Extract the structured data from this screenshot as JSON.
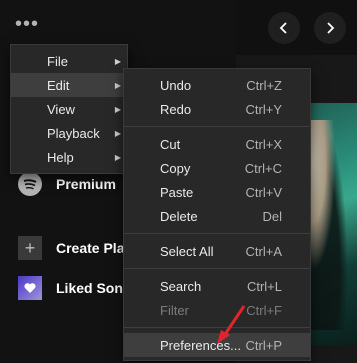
{
  "topbar": {
    "more_icon": "more-horizontal-icon",
    "back_icon": "chevron-left-icon",
    "forward_icon": "chevron-right-icon"
  },
  "sidebar": {
    "items": [
      {
        "label": "Premium",
        "icon": "spotify-logo-icon"
      },
      {
        "label": "Create Pla",
        "icon": "plus-icon"
      },
      {
        "label": "Liked Son",
        "icon": "heart-icon"
      }
    ]
  },
  "menu": {
    "items": [
      {
        "label": "File",
        "arrow": "▶"
      },
      {
        "label": "Edit",
        "arrow": "▶"
      },
      {
        "label": "View",
        "arrow": "▶"
      },
      {
        "label": "Playback",
        "arrow": "▶"
      },
      {
        "label": "Help",
        "arrow": "▶"
      }
    ]
  },
  "edit_menu": {
    "groups": [
      [
        {
          "label": "Undo",
          "shortcut": "Ctrl+Z"
        },
        {
          "label": "Redo",
          "shortcut": "Ctrl+Y"
        }
      ],
      [
        {
          "label": "Cut",
          "shortcut": "Ctrl+X"
        },
        {
          "label": "Copy",
          "shortcut": "Ctrl+C"
        },
        {
          "label": "Paste",
          "shortcut": "Ctrl+V"
        },
        {
          "label": "Delete",
          "shortcut": "Del"
        }
      ],
      [
        {
          "label": "Select All",
          "shortcut": "Ctrl+A"
        }
      ],
      [
        {
          "label": "Search",
          "shortcut": "Ctrl+L"
        },
        {
          "label": "Filter",
          "shortcut": "Ctrl+F"
        }
      ],
      [
        {
          "label": "Preferences...",
          "shortcut": "Ctrl+P"
        }
      ]
    ]
  },
  "colors": {
    "accent_arrow": "#e0262a",
    "menu_bg": "#282828",
    "app_bg": "#121212"
  }
}
